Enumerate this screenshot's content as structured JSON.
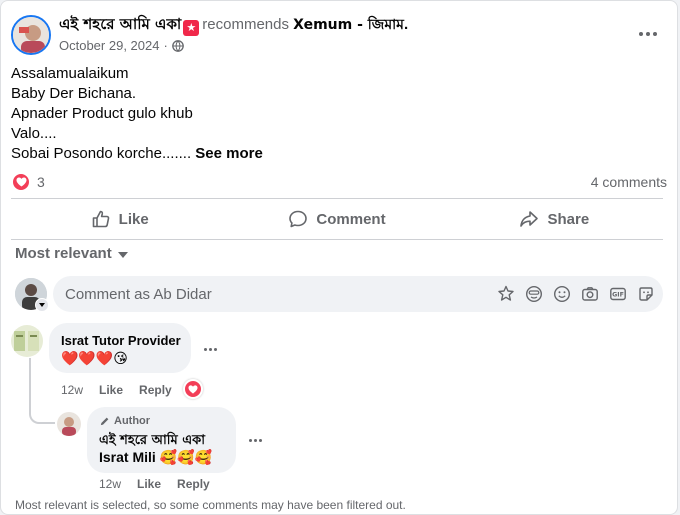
{
  "post": {
    "author": "এই শহরে আমি একা",
    "badge_icon": "heart-badge-icon",
    "action": "recommends",
    "page": "Xemum - জিমাম",
    "page_suffix": ".",
    "date": "October 29, 2024",
    "separator": "·",
    "privacy_icon": "globe-icon",
    "text_lines": [
      "Assalamualaikum",
      "Baby Der Bichana.",
      "Apnader Product gulo khub",
      "Valo....",
      "Sobai Posondo korche......."
    ],
    "see_more": "See more"
  },
  "reactions": {
    "icon": "love-reaction-icon",
    "count": "3",
    "comments": "4 comments"
  },
  "actions": {
    "like": "Like",
    "comment": "Comment",
    "share": "Share"
  },
  "sort": {
    "label": "Most relevant"
  },
  "composer": {
    "placeholder": "Comment as Ab Didar",
    "icons": [
      "avatar-sticker-icon",
      "emoji-icon",
      "smiley-icon",
      "camera-icon",
      "gif-icon",
      "sticker-icon"
    ]
  },
  "comments": [
    {
      "name": "Israt Tutor Provider",
      "text": "❤️❤️❤️😘",
      "time": "12w",
      "like": "Like",
      "reply": "Reply",
      "reaction_icon": "love-reaction-icon"
    }
  ],
  "reply": {
    "tag": "Author",
    "name": "এই শহরে আমি একা",
    "text_line1": "Israt Mili 🥰🥰🥰",
    "time": "12w",
    "like": "Like",
    "reply": "Reply"
  },
  "footer": {
    "note": "Most relevant is selected, so some comments may have been filtered out."
  },
  "colors": {
    "accent": "#1877f2",
    "love": "#f33e58",
    "secondary_text": "#65676b",
    "bubble": "#f0f2f5"
  }
}
